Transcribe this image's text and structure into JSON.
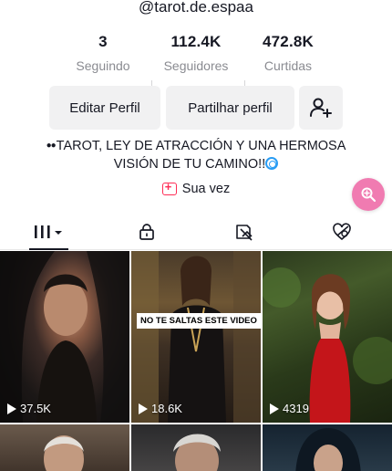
{
  "profile": {
    "handle": "@tarot.de.espaa",
    "stats": [
      {
        "value": "3",
        "label": "Seguindo"
      },
      {
        "value": "112.4K",
        "label": "Seguidores"
      },
      {
        "value": "472.8K",
        "label": "Curtidas"
      }
    ],
    "buttons": {
      "edit": "Editar Perfil",
      "share": "Partilhar perfil",
      "add_friend_icon": "person-add-icon"
    },
    "bio": {
      "line1": "TAROT, LEY DE ATRACCIÓN Y UNA HERMOSA",
      "line2": "VISIÓN DE TU CAMINO!!",
      "emoji_start": "eyes-emoji",
      "emoji_end": "cyclone-emoji"
    },
    "your_turn": "Sua vez"
  },
  "tabs": [
    {
      "icon": "videos-grid-icon",
      "selected": true
    },
    {
      "icon": "lock-icon",
      "selected": false
    },
    {
      "icon": "repost-icon",
      "selected": false
    },
    {
      "icon": "liked-hidden-icon",
      "selected": false
    }
  ],
  "videos": [
    {
      "views": "37.5K",
      "caption": ""
    },
    {
      "views": "18.6K",
      "caption": "NO TE SALTAS ESTE VIDEO"
    },
    {
      "views": "4319",
      "caption": ""
    }
  ],
  "colors": {
    "accent": "#fe2c55",
    "fab": "#f07bb1",
    "button_bg": "#f1f1f2",
    "muted_text": "#8a8b91"
  }
}
